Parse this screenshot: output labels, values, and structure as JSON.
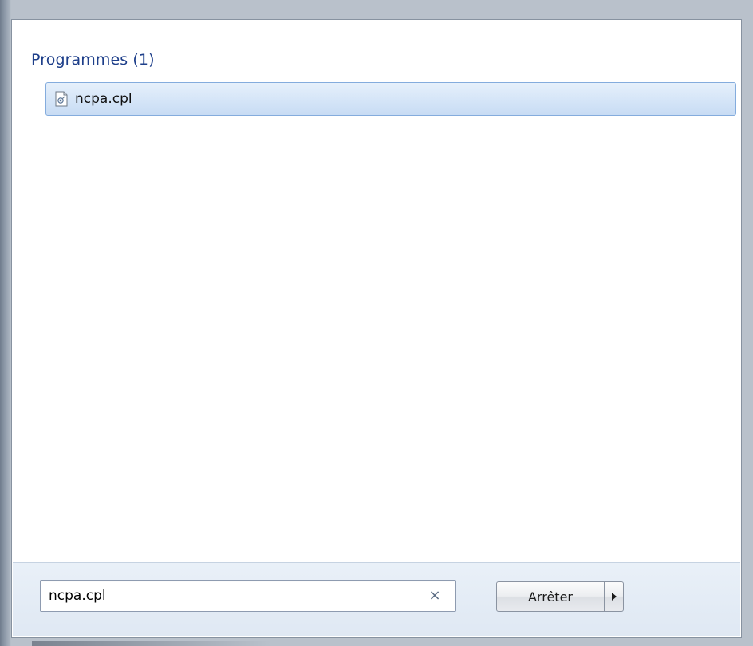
{
  "search_results": {
    "group_title": "Programmes (1)",
    "items": [
      {
        "label": "ncpa.cpl",
        "icon": "control-panel-file-icon"
      }
    ]
  },
  "search": {
    "value": "ncpa.cpl",
    "clear_symbol": "×"
  },
  "power": {
    "shutdown_label": "Arrêter",
    "arrow_icon": "chevron-right-icon"
  },
  "colors": {
    "group_title": "#1e3f8a",
    "selection_border": "#84acdd",
    "selection_fill": "#d8e7f8",
    "bottom_bar": "#e4ecf6"
  }
}
